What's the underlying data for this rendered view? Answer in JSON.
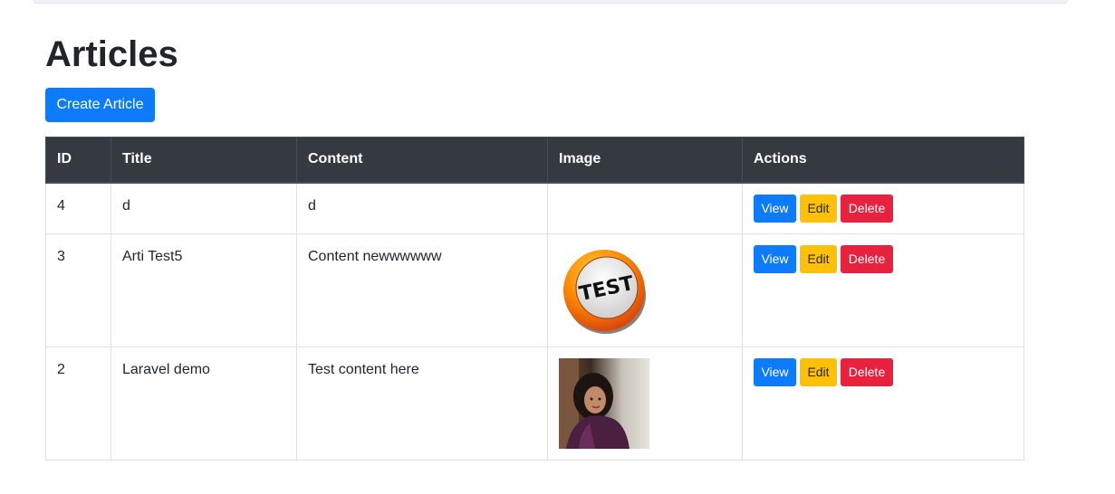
{
  "page": {
    "title": "Articles"
  },
  "toolbar": {
    "create_label": "Create Article"
  },
  "table": {
    "headers": [
      "ID",
      "Title",
      "Content",
      "Image",
      "Actions"
    ],
    "rows": [
      {
        "id": "4",
        "title": "d",
        "content": "d",
        "image": "none"
      },
      {
        "id": "3",
        "title": "Arti Test5",
        "content": "Content newwwwww",
        "image": "test-badge",
        "image_text": "TEST"
      },
      {
        "id": "2",
        "title": "Laravel demo",
        "content": "Test content here",
        "image": "portrait-photo"
      }
    ],
    "actions": {
      "view": "View",
      "edit": "Edit",
      "delete": "Delete"
    }
  },
  "colors": {
    "primary": "#0d7bfb",
    "warning": "#ffc107",
    "danger": "#e8213f",
    "table_header": "#343a40"
  }
}
